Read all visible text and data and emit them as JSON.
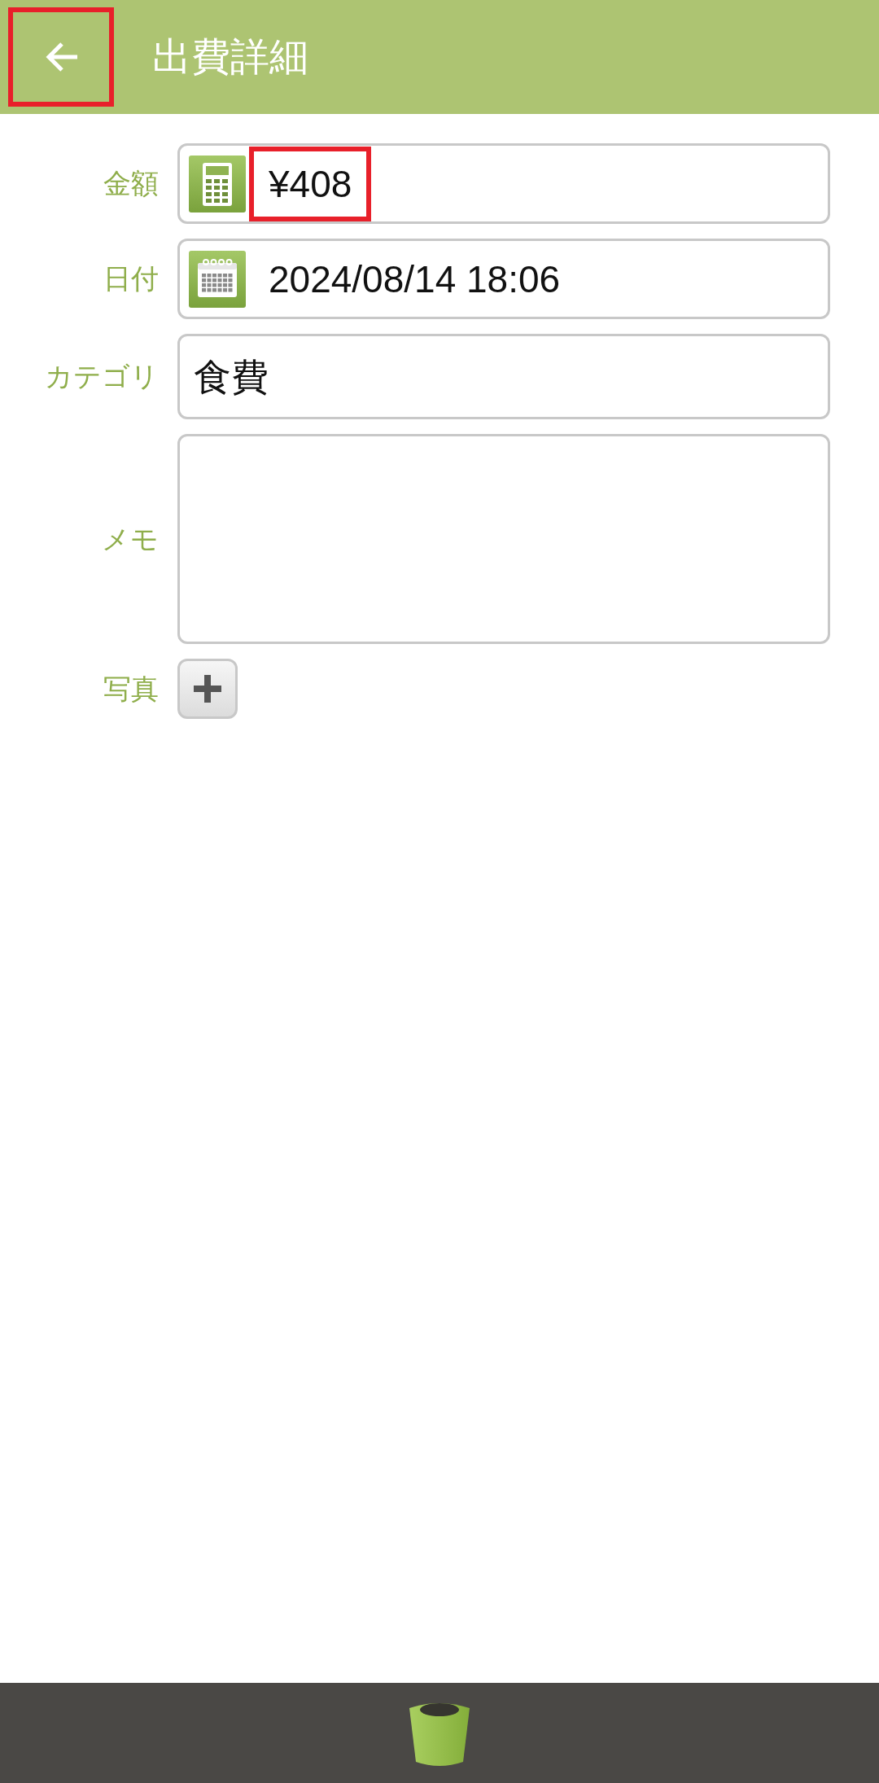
{
  "app_bar": {
    "back_button": {
      "highlighted": true
    },
    "title": "出費詳細"
  },
  "fields": [
    {
      "kind": "amount",
      "label": "金額",
      "value": "¥408",
      "highlighted": true
    },
    {
      "kind": "date",
      "label": "日付",
      "value": "2024/08/14 18:06",
      "highlighted": false
    },
    {
      "kind": "category",
      "label": "カテゴリ",
      "value": "食費",
      "highlighted": false
    },
    {
      "kind": "memo",
      "label": "メモ",
      "highlighted": false
    },
    {
      "kind": "photo",
      "label": "写真",
      "highlighted": false
    }
  ]
}
